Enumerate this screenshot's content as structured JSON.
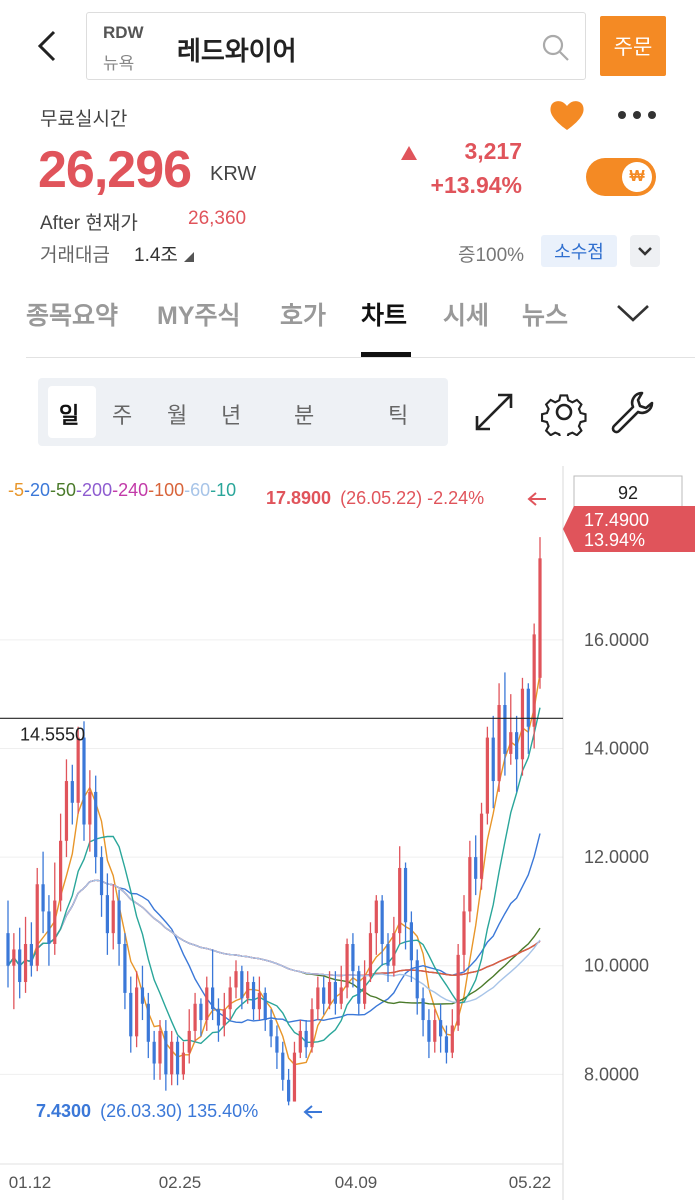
{
  "header": {
    "ticker": "RDW",
    "market": "뉴욕",
    "name": "레드와이어",
    "order_label": "주문"
  },
  "price": {
    "realtime_label": "무료실시간",
    "value": "26,296",
    "currency": "KRW",
    "change": "3,217",
    "change_pct": "+13.94%",
    "after_label": "After 현재가",
    "after_value": "26,360",
    "volume_label": "거래대금",
    "volume_value": "1.4조",
    "zoom_label": "증100%",
    "decimal_label": "소수점",
    "toggle_symbol": "₩"
  },
  "tabs": [
    "종목요약",
    "MY주식",
    "호가",
    "차트",
    "시세",
    "뉴스"
  ],
  "active_tab": "차트",
  "periods": [
    "일",
    "주",
    "월",
    "년",
    "분",
    "틱"
  ],
  "active_period": "일",
  "colors": {
    "accent": "#f48a24",
    "up": "#e0545b",
    "down": "#3b78d8"
  },
  "chart_data": {
    "type": "candlestick",
    "ma_legend": [
      {
        "label": "5",
        "color": "#e8962a"
      },
      {
        "label": "20",
        "color": "#3b78d8"
      },
      {
        "label": "50",
        "color": "#4a7a2a"
      },
      {
        "label": "200",
        "color": "#8e5cd0"
      },
      {
        "label": "240",
        "color": "#c23aa8"
      },
      {
        "label": "100",
        "color": "#d8643a"
      },
      {
        "label": "60",
        "color": "#a7c4e8"
      },
      {
        "label": "10",
        "color": "#2aa69a"
      }
    ],
    "high_marker": "17.8900",
    "high_info": "(26.05.22) -2.24%",
    "low_marker": "7.4300",
    "low_info": "(26.03.30) 135.40%",
    "crosshair_value": "14.5550",
    "candle_count_label": "92",
    "last_price": "17.4900",
    "last_change": "13.94%",
    "y_ticks": [
      "16.0000",
      "14.0000",
      "12.0000",
      "10.0000",
      "8.0000"
    ],
    "x_ticks": [
      "01.12",
      "02.25",
      "04.09",
      "05.22"
    ],
    "ylim": [
      6.35,
      19.2
    ],
    "candles": [
      [
        10.6,
        10.0,
        11.2,
        9.6
      ],
      [
        10.0,
        10.3,
        10.6,
        9.2
      ],
      [
        10.3,
        9.7,
        10.7,
        9.4
      ],
      [
        9.7,
        10.4,
        10.9,
        9.5
      ],
      [
        10.4,
        10.0,
        10.8,
        9.8
      ],
      [
        10.0,
        11.5,
        11.8,
        9.9
      ],
      [
        11.5,
        11.0,
        12.1,
        10.6
      ],
      [
        11.0,
        10.4,
        11.3,
        10.0
      ],
      [
        10.4,
        11.2,
        11.9,
        10.2
      ],
      [
        11.2,
        12.3,
        12.8,
        11.0
      ],
      [
        12.3,
        13.4,
        13.8,
        12.0
      ],
      [
        13.4,
        13.0,
        13.7,
        12.6
      ],
      [
        13.0,
        14.2,
        14.4,
        12.8
      ],
      [
        14.2,
        12.6,
        14.5,
        12.3
      ],
      [
        12.6,
        13.2,
        13.6,
        12.1
      ],
      [
        13.2,
        12.0,
        13.5,
        11.7
      ],
      [
        12.0,
        11.3,
        12.2,
        10.9
      ],
      [
        11.3,
        10.6,
        11.7,
        10.2
      ],
      [
        10.6,
        11.2,
        11.5,
        10.3
      ],
      [
        11.2,
        10.4,
        11.4,
        10.0
      ],
      [
        10.4,
        9.5,
        10.6,
        9.2
      ],
      [
        9.5,
        8.7,
        9.8,
        8.4
      ],
      [
        8.7,
        9.6,
        9.9,
        8.5
      ],
      [
        9.6,
        9.3,
        10.0,
        9.0
      ],
      [
        9.3,
        8.6,
        9.5,
        8.3
      ],
      [
        8.6,
        8.2,
        8.8,
        7.9
      ],
      [
        8.2,
        8.8,
        9.0,
        7.9
      ],
      [
        8.8,
        8.0,
        9.0,
        7.7
      ],
      [
        8.0,
        8.6,
        8.8,
        7.8
      ],
      [
        8.6,
        8.0,
        8.7,
        7.8
      ],
      [
        8.0,
        8.4,
        8.6,
        7.9
      ],
      [
        8.4,
        8.8,
        9.2,
        8.2
      ],
      [
        8.8,
        9.3,
        9.5,
        8.6
      ],
      [
        9.3,
        9.0,
        9.4,
        8.7
      ],
      [
        9.0,
        9.6,
        9.8,
        8.8
      ],
      [
        9.6,
        9.2,
        10.3,
        9.0
      ],
      [
        9.2,
        8.9,
        9.4,
        8.6
      ],
      [
        8.9,
        9.2,
        9.5,
        8.7
      ],
      [
        9.2,
        9.6,
        9.8,
        9.0
      ],
      [
        9.6,
        9.9,
        10.1,
        9.4
      ],
      [
        9.9,
        9.4,
        10.0,
        9.2
      ],
      [
        9.4,
        9.7,
        9.9,
        9.3
      ],
      [
        9.7,
        9.2,
        9.8,
        9.0
      ],
      [
        9.2,
        9.5,
        9.8,
        9.0
      ],
      [
        9.5,
        9.0,
        9.6,
        8.8
      ],
      [
        9.0,
        8.7,
        9.2,
        8.5
      ],
      [
        8.7,
        8.4,
        8.9,
        8.1
      ],
      [
        8.4,
        7.9,
        8.6,
        7.7
      ],
      [
        7.9,
        7.5,
        8.1,
        7.43
      ],
      [
        7.5,
        8.4,
        8.6,
        7.5
      ],
      [
        8.4,
        8.8,
        9.0,
        8.3
      ],
      [
        8.8,
        8.5,
        9.0,
        8.3
      ],
      [
        8.5,
        9.2,
        9.4,
        8.4
      ],
      [
        9.2,
        9.6,
        9.8,
        9.0
      ],
      [
        9.6,
        9.3,
        9.8,
        9.1
      ],
      [
        9.3,
        9.7,
        9.9,
        9.2
      ],
      [
        9.7,
        9.3,
        9.9,
        9.1
      ],
      [
        9.3,
        9.6,
        10.0,
        9.2
      ],
      [
        9.6,
        10.4,
        10.5,
        9.4
      ],
      [
        10.4,
        9.9,
        10.6,
        9.6
      ],
      [
        9.9,
        9.3,
        10.0,
        9.1
      ],
      [
        9.3,
        9.8,
        10.1,
        9.2
      ],
      [
        9.8,
        10.6,
        10.8,
        9.7
      ],
      [
        10.6,
        11.2,
        11.3,
        10.2
      ],
      [
        11.2,
        10.4,
        11.3,
        10.0
      ],
      [
        10.4,
        10.0,
        10.6,
        9.7
      ],
      [
        10.0,
        10.6,
        10.9,
        9.8
      ],
      [
        10.6,
        11.8,
        12.2,
        10.4
      ],
      [
        11.8,
        10.8,
        11.9,
        10.3
      ],
      [
        10.8,
        10.1,
        11.0,
        9.7
      ],
      [
        10.1,
        9.4,
        10.3,
        9.1
      ],
      [
        9.4,
        9.0,
        9.6,
        8.7
      ],
      [
        9.0,
        8.6,
        9.2,
        8.3
      ],
      [
        8.6,
        9.0,
        9.2,
        8.4
      ],
      [
        9.0,
        8.7,
        9.3,
        8.4
      ],
      [
        8.7,
        8.4,
        8.9,
        8.2
      ],
      [
        8.4,
        8.9,
        9.2,
        8.3
      ],
      [
        8.9,
        10.2,
        10.4,
        8.8
      ],
      [
        10.2,
        11.0,
        11.3,
        9.9
      ],
      [
        11.0,
        12.0,
        12.3,
        10.8
      ],
      [
        12.0,
        11.6,
        12.4,
        11.3
      ],
      [
        11.6,
        12.8,
        13.0,
        11.4
      ],
      [
        12.8,
        14.2,
        14.4,
        12.6
      ],
      [
        14.2,
        13.4,
        14.6,
        12.9
      ],
      [
        13.4,
        14.8,
        15.2,
        13.2
      ],
      [
        14.8,
        13.9,
        15.4,
        13.5
      ],
      [
        13.9,
        14.3,
        15.0,
        13.7
      ],
      [
        14.3,
        13.8,
        14.6,
        13.2
      ],
      [
        13.8,
        15.1,
        15.3,
        13.5
      ],
      [
        15.1,
        14.4,
        15.2,
        13.9
      ],
      [
        14.4,
        16.1,
        16.3,
        14.0
      ],
      [
        15.3,
        17.5,
        17.89,
        15.1
      ]
    ]
  }
}
